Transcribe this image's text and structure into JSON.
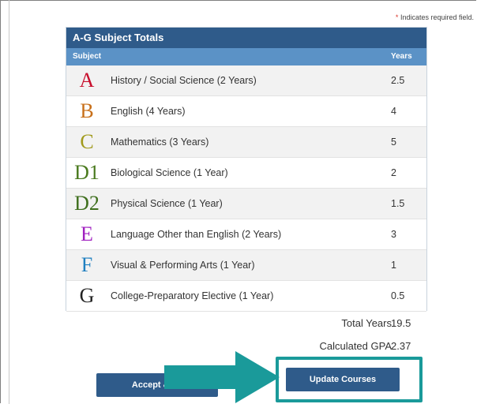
{
  "required_note": {
    "star": "*",
    "text": " Indicates required field."
  },
  "panel": {
    "title": "A-G Subject Totals",
    "col_subject": "Subject",
    "col_years": "Years",
    "rows": [
      {
        "letter": "A",
        "color": "#c8102e",
        "subject": "History / Social Science (2 Years)",
        "years": "2.5"
      },
      {
        "letter": "B",
        "color": "#c8701a",
        "subject": "English (4 Years)",
        "years": "4"
      },
      {
        "letter": "C",
        "color": "#a19a1c",
        "subject": "Mathematics (3 Years)",
        "years": "5"
      },
      {
        "letter": "D1",
        "color": "#4a7a1e",
        "subject": "Biological Science (1 Year)",
        "years": "2"
      },
      {
        "letter": "D2",
        "color": "#3f6f1e",
        "subject": "Physical Science (1 Year)",
        "years": "1.5"
      },
      {
        "letter": "E",
        "color": "#a020c0",
        "subject": "Language Other than English (2 Years)",
        "years": "3"
      },
      {
        "letter": "F",
        "color": "#1f7fc0",
        "subject": "Visual & Performing Arts (1 Year)",
        "years": "1"
      },
      {
        "letter": "G",
        "color": "#222222",
        "subject": "College-Preparatory Elective (1 Year)",
        "years": "0.5"
      }
    ]
  },
  "summary": {
    "total_label": "Total Years",
    "total_value": "19.5",
    "gpa_label": "Calculated GPA",
    "gpa_value": "2.37"
  },
  "buttons": {
    "accept": "Accept & Sa",
    "update": "Update Courses"
  },
  "colors": {
    "arrow": "#1a9a9a",
    "highlight": "#1a9a9a"
  }
}
